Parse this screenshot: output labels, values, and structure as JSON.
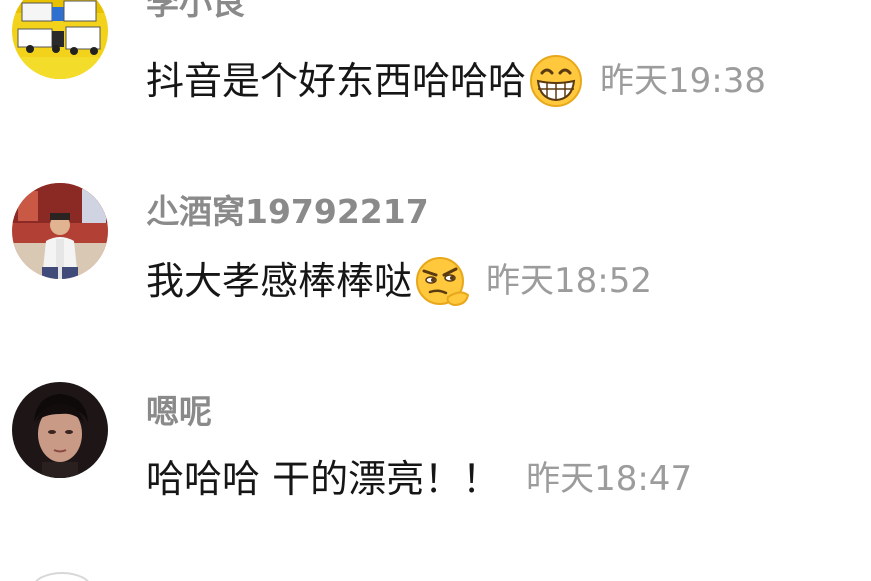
{
  "comments": [
    {
      "username": "李小良",
      "text": "抖音是个好东西哈哈哈",
      "emoji": "grinning-face-emoji",
      "time": "昨天19:38"
    },
    {
      "username": "尐酒窝19792217",
      "text": "我大孝感棒棒哒",
      "emoji": "thinking-smirk-emoji",
      "time": "昨天18:52"
    },
    {
      "username": "嗯呢",
      "text": "哈哈哈 干的漂亮！！",
      "emoji": "",
      "time": "昨天18:47"
    }
  ],
  "colors": {
    "username": "#8a8a8a",
    "text": "#161616",
    "time": "#9c9c9c",
    "emoji_yellow": "#ffc83d"
  }
}
